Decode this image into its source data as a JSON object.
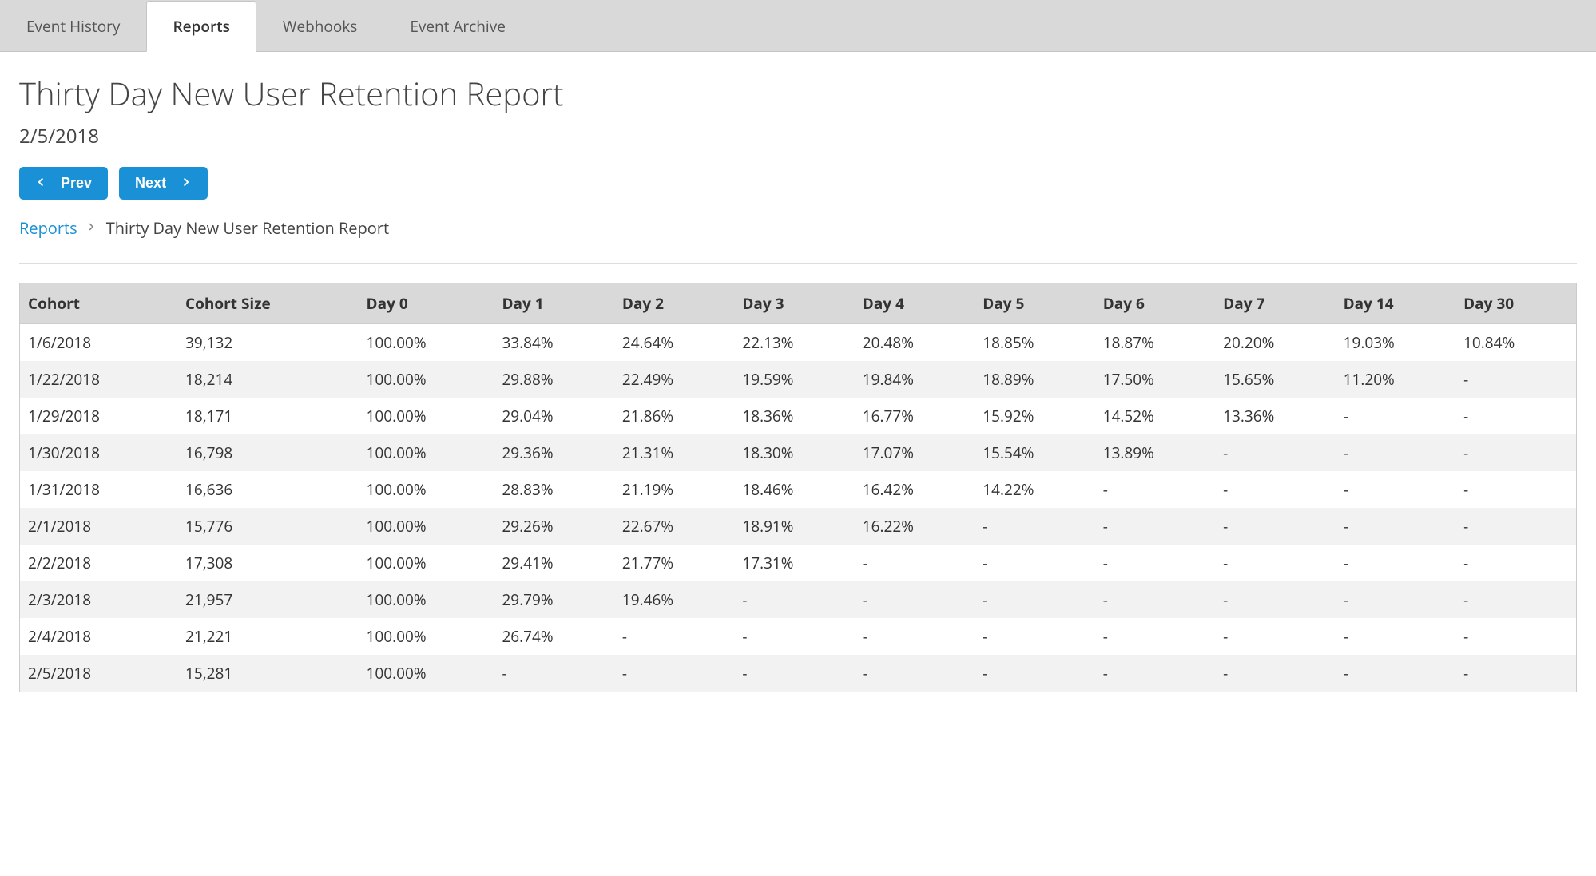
{
  "tabs": [
    {
      "label": "Event History",
      "active": false
    },
    {
      "label": "Reports",
      "active": true
    },
    {
      "label": "Webhooks",
      "active": false
    },
    {
      "label": "Event Archive",
      "active": false
    }
  ],
  "page": {
    "title": "Thirty Day New User Retention Report",
    "date": "2/5/2018"
  },
  "nav": {
    "prev_label": "Prev",
    "next_label": "Next"
  },
  "breadcrumb": {
    "root": "Reports",
    "current": "Thirty Day New User Retention Report"
  },
  "table": {
    "headers": [
      "Cohort",
      "Cohort Size",
      "Day 0",
      "Day 1",
      "Day 2",
      "Day 3",
      "Day 4",
      "Day 5",
      "Day 6",
      "Day 7",
      "Day 14",
      "Day 30"
    ],
    "rows": [
      [
        "1/6/2018",
        "39,132",
        "100.00%",
        "33.84%",
        "24.64%",
        "22.13%",
        "20.48%",
        "18.85%",
        "18.87%",
        "20.20%",
        "19.03%",
        "10.84%"
      ],
      [
        "1/22/2018",
        "18,214",
        "100.00%",
        "29.88%",
        "22.49%",
        "19.59%",
        "19.84%",
        "18.89%",
        "17.50%",
        "15.65%",
        "11.20%",
        "-"
      ],
      [
        "1/29/2018",
        "18,171",
        "100.00%",
        "29.04%",
        "21.86%",
        "18.36%",
        "16.77%",
        "15.92%",
        "14.52%",
        "13.36%",
        "-",
        "-"
      ],
      [
        "1/30/2018",
        "16,798",
        "100.00%",
        "29.36%",
        "21.31%",
        "18.30%",
        "17.07%",
        "15.54%",
        "13.89%",
        "-",
        "-",
        "-"
      ],
      [
        "1/31/2018",
        "16,636",
        "100.00%",
        "28.83%",
        "21.19%",
        "18.46%",
        "16.42%",
        "14.22%",
        "-",
        "-",
        "-",
        "-"
      ],
      [
        "2/1/2018",
        "15,776",
        "100.00%",
        "29.26%",
        "22.67%",
        "18.91%",
        "16.22%",
        "-",
        "-",
        "-",
        "-",
        "-"
      ],
      [
        "2/2/2018",
        "17,308",
        "100.00%",
        "29.41%",
        "21.77%",
        "17.31%",
        "-",
        "-",
        "-",
        "-",
        "-",
        "-"
      ],
      [
        "2/3/2018",
        "21,957",
        "100.00%",
        "29.79%",
        "19.46%",
        "-",
        "-",
        "-",
        "-",
        "-",
        "-",
        "-"
      ],
      [
        "2/4/2018",
        "21,221",
        "100.00%",
        "26.74%",
        "-",
        "-",
        "-",
        "-",
        "-",
        "-",
        "-",
        "-"
      ],
      [
        "2/5/2018",
        "15,281",
        "100.00%",
        "-",
        "-",
        "-",
        "-",
        "-",
        "-",
        "-",
        "-",
        "-"
      ]
    ]
  },
  "chart_data": {
    "type": "table",
    "title": "Thirty Day New User Retention Report",
    "date": "2/5/2018",
    "columns": [
      "Cohort",
      "Cohort Size",
      "Day 0",
      "Day 1",
      "Day 2",
      "Day 3",
      "Day 4",
      "Day 5",
      "Day 6",
      "Day 7",
      "Day 14",
      "Day 30"
    ],
    "cohorts": [
      {
        "cohort": "1/6/2018",
        "size": 39132,
        "retention_pct": {
          "0": 100.0,
          "1": 33.84,
          "2": 24.64,
          "3": 22.13,
          "4": 20.48,
          "5": 18.85,
          "6": 18.87,
          "7": 20.2,
          "14": 19.03,
          "30": 10.84
        }
      },
      {
        "cohort": "1/22/2018",
        "size": 18214,
        "retention_pct": {
          "0": 100.0,
          "1": 29.88,
          "2": 22.49,
          "3": 19.59,
          "4": 19.84,
          "5": 18.89,
          "6": 17.5,
          "7": 15.65,
          "14": 11.2
        }
      },
      {
        "cohort": "1/29/2018",
        "size": 18171,
        "retention_pct": {
          "0": 100.0,
          "1": 29.04,
          "2": 21.86,
          "3": 18.36,
          "4": 16.77,
          "5": 15.92,
          "6": 14.52,
          "7": 13.36
        }
      },
      {
        "cohort": "1/30/2018",
        "size": 16798,
        "retention_pct": {
          "0": 100.0,
          "1": 29.36,
          "2": 21.31,
          "3": 18.3,
          "4": 17.07,
          "5": 15.54,
          "6": 13.89
        }
      },
      {
        "cohort": "1/31/2018",
        "size": 16636,
        "retention_pct": {
          "0": 100.0,
          "1": 28.83,
          "2": 21.19,
          "3": 18.46,
          "4": 16.42,
          "5": 14.22
        }
      },
      {
        "cohort": "2/1/2018",
        "size": 15776,
        "retention_pct": {
          "0": 100.0,
          "1": 29.26,
          "2": 22.67,
          "3": 18.91,
          "4": 16.22
        }
      },
      {
        "cohort": "2/2/2018",
        "size": 17308,
        "retention_pct": {
          "0": 100.0,
          "1": 29.41,
          "2": 21.77,
          "3": 17.31
        }
      },
      {
        "cohort": "2/3/2018",
        "size": 21957,
        "retention_pct": {
          "0": 100.0,
          "1": 29.79,
          "2": 19.46
        }
      },
      {
        "cohort": "2/4/2018",
        "size": 21221,
        "retention_pct": {
          "0": 100.0,
          "1": 26.74
        }
      },
      {
        "cohort": "2/5/2018",
        "size": 15281,
        "retention_pct": {
          "0": 100.0
        }
      }
    ]
  }
}
